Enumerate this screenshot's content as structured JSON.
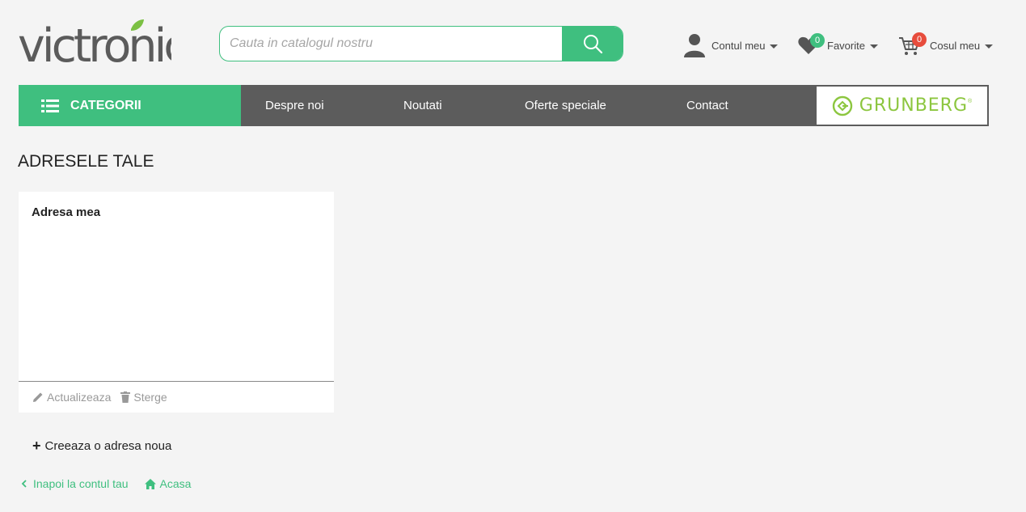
{
  "brand": {
    "logo_text": "victronic",
    "accent": "#3fbf7f",
    "partner_logo": "GRUNBERG"
  },
  "search": {
    "placeholder": "Cauta in catalogul nostru",
    "button_icon": "search-icon"
  },
  "header": {
    "account_label": "Contul meu",
    "favorites_label": "Favorite",
    "favorites_count": "0",
    "cart_label": "Cosul meu",
    "cart_count": "0"
  },
  "nav": {
    "categories_label": "CATEGORII",
    "links": [
      "Despre noi",
      "Noutati",
      "Oferte speciale",
      "Contact"
    ]
  },
  "main": {
    "title": "ADRESELE TALE",
    "address_card": {
      "title": "Adresa mea",
      "update_label": "Actualizeaza",
      "delete_label": "Sterge"
    },
    "create_label": "Creeaza o adresa noua",
    "back_label": "Inapoi la contul tau",
    "home_label": "Acasa"
  }
}
